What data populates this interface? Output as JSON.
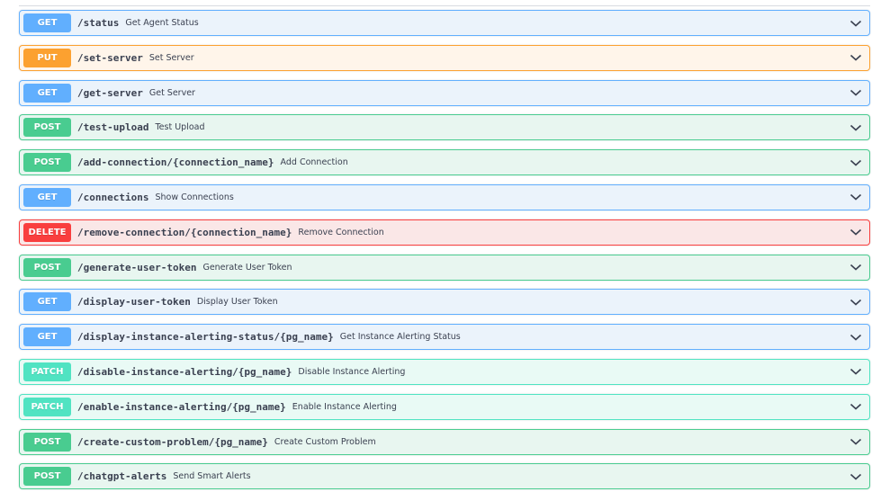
{
  "operations": [
    {
      "method": "GET",
      "type": "get",
      "path": "/status",
      "summary": "Get Agent Status"
    },
    {
      "method": "PUT",
      "type": "put",
      "path": "/set-server",
      "summary": "Set Server"
    },
    {
      "method": "GET",
      "type": "get",
      "path": "/get-server",
      "summary": "Get Server"
    },
    {
      "method": "POST",
      "type": "post",
      "path": "/test-upload",
      "summary": "Test Upload"
    },
    {
      "method": "POST",
      "type": "post",
      "path": "/add-connection/{connection_name}",
      "summary": "Add Connection"
    },
    {
      "method": "GET",
      "type": "get",
      "path": "/connections",
      "summary": "Show Connections"
    },
    {
      "method": "DELETE",
      "type": "delete",
      "path": "/remove-connection/{connection_name}",
      "summary": "Remove Connection"
    },
    {
      "method": "POST",
      "type": "post",
      "path": "/generate-user-token",
      "summary": "Generate User Token"
    },
    {
      "method": "GET",
      "type": "get",
      "path": "/display-user-token",
      "summary": "Display User Token"
    },
    {
      "method": "GET",
      "type": "get",
      "path": "/display-instance-alerting-status/{pg_name}",
      "summary": "Get Instance Alerting Status"
    },
    {
      "method": "PATCH",
      "type": "patch",
      "path": "/disable-instance-alerting/{pg_name}",
      "summary": "Disable Instance Alerting"
    },
    {
      "method": "PATCH",
      "type": "patch",
      "path": "/enable-instance-alerting/{pg_name}",
      "summary": "Enable Instance Alerting"
    },
    {
      "method": "POST",
      "type": "post",
      "path": "/create-custom-problem/{pg_name}",
      "summary": "Create Custom Problem"
    },
    {
      "method": "POST",
      "type": "post",
      "path": "/chatgpt-alerts",
      "summary": "Send Smart Alerts"
    }
  ],
  "colors": {
    "get": "#61affe",
    "put": "#fca130",
    "post": "#49cc90",
    "delete": "#f93e3e",
    "patch": "#50e3c2",
    "text": "#3b4151"
  },
  "icons": {
    "expand": "chevron-down-icon"
  }
}
